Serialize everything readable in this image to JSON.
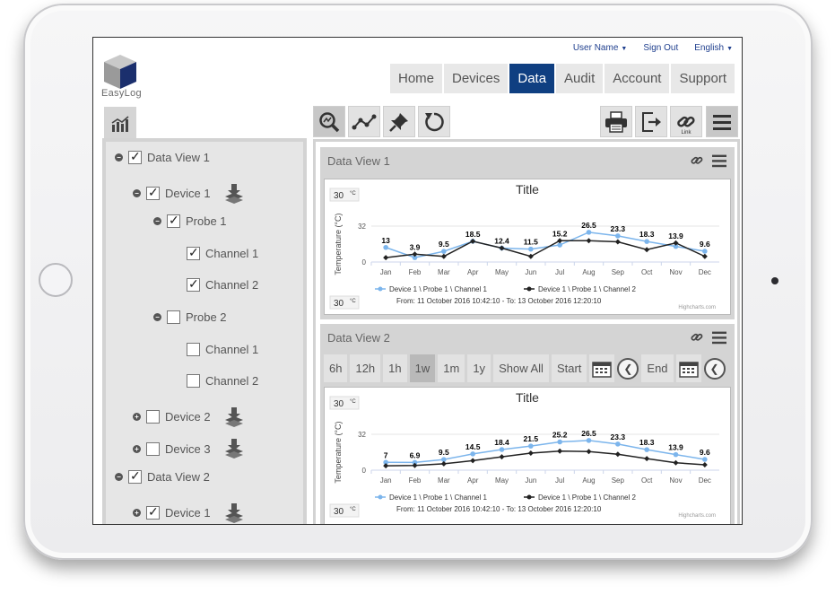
{
  "brand": {
    "logo_text": "EasyLog"
  },
  "top_links": {
    "user": "User Name",
    "signout": "Sign Out",
    "language": "English"
  },
  "nav": [
    "Home",
    "Devices",
    "Data",
    "Audit",
    "Account",
    "Support"
  ],
  "nav_active": "Data",
  "toolbar": {
    "link_label": "Link"
  },
  "tree": [
    {
      "label": "Data View 1",
      "level": 0,
      "toggle": "−",
      "checked": true,
      "layers": false
    },
    {
      "label": "Device 1",
      "level": 1,
      "toggle": "−",
      "checked": true,
      "layers": true
    },
    {
      "label": "Probe 1",
      "level": 2,
      "toggle": "−",
      "checked": true,
      "layers": false
    },
    {
      "label": "Channel 1",
      "level": 3,
      "toggle": "",
      "checked": true,
      "layers": false
    },
    {
      "label": "Channel 2",
      "level": 3,
      "toggle": "",
      "checked": true,
      "layers": false
    },
    {
      "label": "Probe 2",
      "level": 2,
      "toggle": "−",
      "checked": false,
      "layers": false
    },
    {
      "label": "Channel 1",
      "level": 3,
      "toggle": "",
      "checked": false,
      "layers": false
    },
    {
      "label": "Channel 2",
      "level": 3,
      "toggle": "",
      "checked": false,
      "layers": false
    },
    {
      "label": "Device 2",
      "level": 1,
      "toggle": "+",
      "checked": false,
      "layers": true
    },
    {
      "label": "Device 3",
      "level": 1,
      "toggle": "+",
      "checked": false,
      "layers": true
    },
    {
      "label": "Data View 2",
      "level": 0,
      "toggle": "−",
      "checked": true,
      "layers": false
    },
    {
      "label": "Device 1",
      "level": 1,
      "toggle": "+",
      "checked": true,
      "layers": true
    }
  ],
  "panels": [
    {
      "title": "Data View 1"
    },
    {
      "title": "Data View 2"
    }
  ],
  "range_buttons": [
    "6h",
    "12h",
    "1h",
    "1w",
    "1m",
    "1y",
    "Show All"
  ],
  "range_active": "1w",
  "range_start": "Start",
  "range_end": "End",
  "colors": {
    "series1": "#7cb5ec",
    "series2": "#222222",
    "nav_active": "#0f3f81"
  },
  "chart_data": [
    {
      "type": "line",
      "title": "Title",
      "ylabel": "Temperature (°C)",
      "ylim": [
        0,
        32
      ],
      "yticks": [
        0,
        32
      ],
      "range_input_top": "30",
      "range_input_bottom": "30",
      "range_input_unit": "°C",
      "categories": [
        "Jan",
        "Feb",
        "Mar",
        "Apr",
        "May",
        "Jun",
        "Jul",
        "Aug",
        "Sep",
        "Oct",
        "Nov",
        "Dec"
      ],
      "series": [
        {
          "name": "Device 1 \\ Probe 1 \\ Channel 1",
          "values": [
            13,
            3.9,
            9.5,
            18.5,
            12.4,
            11.5,
            15.2,
            26.5,
            23.3,
            18.3,
            13.9,
            9.6
          ]
        },
        {
          "name": "Device 1 \\ Probe 1 \\ Channel 2",
          "values": [
            3.9,
            7,
            5,
            18.5,
            12.4,
            5,
            19,
            19,
            18,
            11,
            17,
            5
          ]
        }
      ],
      "data_labels": [
        "13",
        "3.9",
        "9.5",
        "18.5",
        "12.4",
        "11.5",
        "15.2",
        "26.5",
        "23.3",
        "18.3",
        "13.9",
        "9.6"
      ],
      "subtitle": "From: 11 October 2016  10:42:10 - To: 13 October 2016  12:20:10",
      "credits": "Highcharts.com"
    },
    {
      "type": "line",
      "title": "Title",
      "ylabel": "Temperature (°C)",
      "ylim": [
        0,
        32
      ],
      "yticks": [
        0,
        32
      ],
      "range_input_top": "30",
      "range_input_bottom": "30",
      "range_input_unit": "°C",
      "categories": [
        "Jan",
        "Feb",
        "Mar",
        "Apr",
        "May",
        "Jun",
        "Jul",
        "Aug",
        "Sep",
        "Oct",
        "Nov",
        "Dec"
      ],
      "series": [
        {
          "name": "Device 1 \\ Probe 1 \\ Channel 1",
          "values": [
            7,
            6.9,
            9.5,
            14.5,
            18.4,
            21.5,
            25.2,
            26.5,
            23.3,
            18.3,
            13.9,
            9.6
          ]
        },
        {
          "name": "Device 1 \\ Probe 1 \\ Channel 2",
          "values": [
            3.9,
            4.2,
            5.7,
            8.5,
            11.9,
            15.2,
            17,
            16.6,
            14.2,
            10.3,
            6.6,
            4.8
          ]
        }
      ],
      "data_labels": [
        "7",
        "6.9",
        "9.5",
        "14.5",
        "18.4",
        "21.5",
        "25.2",
        "26.5",
        "23.3",
        "18.3",
        "13.9",
        "9.6"
      ],
      "subtitle": "From: 11 October 2016  10:42:10 - To: 13 October 2016  12:20:10",
      "credits": "Highcharts.com"
    }
  ]
}
